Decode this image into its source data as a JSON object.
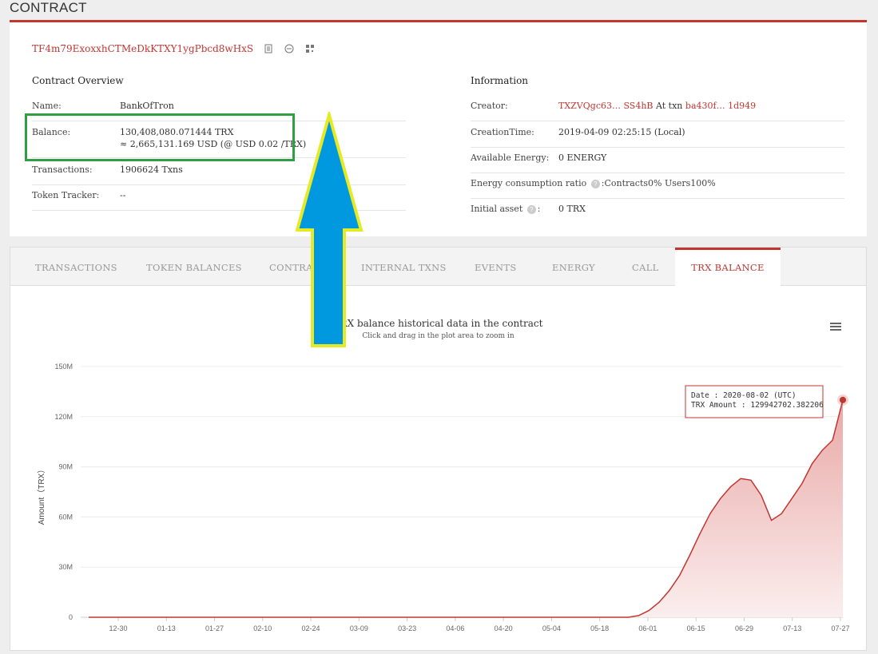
{
  "page_title": "CONTRACT",
  "address": "TF4m79ExoxxhCTMeDkKTXY1ygPbcd8wHxS",
  "overview": {
    "title": "Contract Overview",
    "name_label": "Name:",
    "name_value": "BankOfTron",
    "balance_label": "Balance:",
    "balance_trx": "130,408,080.071444 TRX",
    "balance_usd": "≈ 2,665,131.169 USD (@ USD 0.02 /TRX)",
    "transactions_label": "Transactions:",
    "transactions_value": "1906624  Txns",
    "token_tracker_label": "Token Tracker:",
    "token_tracker_value": "--"
  },
  "information": {
    "title": "Information",
    "creator_label": "Creator:",
    "creator_addr": "TXZVQgc63… SS4hB",
    "creator_at": "At txn",
    "creator_txn": "ba430f… 1d949",
    "creation_label": "CreationTime:",
    "creation_value": "2019-04-09 02:25:15 (Local)",
    "energy_label": "Available Energy:",
    "energy_value": "0  ENERGY",
    "ratio_label": "Energy consumption ratio",
    "ratio_tip": "?",
    "ratio_value": ":Contracts0%  Users100%",
    "initial_label": "Initial asset",
    "initial_tip": "?",
    "initial_colon": ":",
    "initial_value": "0 TRX"
  },
  "tabs": [
    "TRANSACTIONS",
    "TOKEN BALANCES",
    "CONTRACT",
    "INTERNAL TXNS",
    "EVENTS",
    "ENERGY",
    "CALL",
    "TRX BALANCE"
  ],
  "active_tab": "TRX BALANCE",
  "chart_data": {
    "type": "area",
    "title": "TRX balance historical data in the contract",
    "subtitle": "Click and drag in the plot area to zoom in",
    "ylabel": "Amount（TRX）",
    "xlabel": "",
    "y_ticks": [
      "0",
      "30M",
      "60M",
      "90M",
      "120M",
      "150M"
    ],
    "ylim": [
      0,
      150
    ],
    "y_unit": "M",
    "x_ticks": [
      "12-30",
      "01-13",
      "01-27",
      "02-10",
      "02-24",
      "03-09",
      "03-23",
      "04-06",
      "04-20",
      "05-04",
      "05-18",
      "06-01",
      "06-15",
      "06-29",
      "07-13",
      "07-27"
    ],
    "x": [
      "2019-12-30",
      "2020-05-31",
      "2020-06-03",
      "2020-06-06",
      "2020-06-09",
      "2020-06-12",
      "2020-06-15",
      "2020-06-18",
      "2020-06-21",
      "2020-06-24",
      "2020-06-27",
      "2020-06-30",
      "2020-07-03",
      "2020-07-06",
      "2020-07-09",
      "2020-07-12",
      "2020-07-15",
      "2020-07-18",
      "2020-07-21",
      "2020-07-24",
      "2020-07-27",
      "2020-07-30",
      "2020-08-02"
    ],
    "values": [
      0,
      0,
      1,
      4,
      9,
      16,
      25,
      37,
      50,
      62,
      71,
      78,
      83,
      82,
      73,
      58,
      62,
      71,
      80,
      92,
      100,
      106,
      130
    ],
    "tooltip": {
      "date_label": "Date : 2020-08-02 (UTC)",
      "amount_label": "TRX Amount : 129942702.382206"
    },
    "colors": {
      "line": "#c23631",
      "fill_top": "#e8a9a6",
      "fill_bottom": "#fbeeee"
    },
    "grid": true,
    "legend": "none"
  },
  "annotations": {
    "box_color": "#2ea043",
    "arrow_fill": "#0099e0",
    "arrow_stroke": "#e6ea22"
  }
}
